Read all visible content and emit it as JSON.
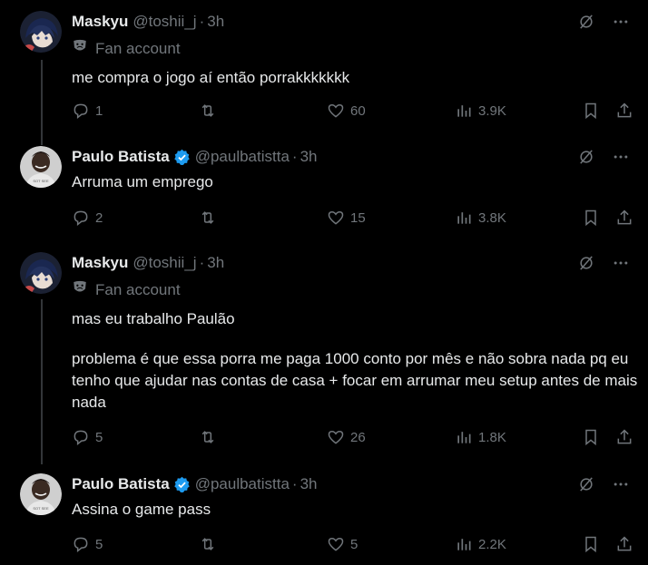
{
  "posts": [
    {
      "name": "Maskyu",
      "handle": "@toshii_j",
      "separator": "·",
      "time": "3h",
      "fan_label": "Fan account",
      "text": [
        "me compra o jogo aí então porrakkkkkkk"
      ],
      "replies": "1",
      "reposts": "",
      "likes": "60",
      "views": "3.9K"
    },
    {
      "name": "Paulo Batista",
      "handle": "@paulbatistta",
      "separator": "·",
      "time": "3h",
      "text": [
        "Arruma um emprego"
      ],
      "replies": "2",
      "reposts": "",
      "likes": "15",
      "views": "3.8K"
    },
    {
      "name": "Maskyu",
      "handle": "@toshii_j",
      "separator": "·",
      "time": "3h",
      "fan_label": "Fan account",
      "text": [
        "mas eu trabalho Paulão",
        "problema é que essa porra me paga 1000 conto por mês e não sobra nada pq eu tenho que ajudar nas contas de casa + focar em arrumar meu setup antes de mais nada"
      ],
      "replies": "5",
      "reposts": "",
      "likes": "26",
      "views": "1.8K"
    },
    {
      "name": "Paulo Batista",
      "handle": "@paulbatistta",
      "separator": "·",
      "time": "3h",
      "text": [
        "Assina o game pass"
      ],
      "replies": "5",
      "reposts": "",
      "likes": "5",
      "views": "2.2K"
    }
  ],
  "colors": {
    "background": "#000000",
    "text": "#e7e9ea",
    "muted": "#71767b",
    "verified": "#1d9bf0",
    "thread_line": "#333639"
  },
  "icons": [
    "grok-icon",
    "more-icon",
    "theater-mask-icon",
    "reply-icon",
    "repost-icon",
    "like-icon",
    "views-icon",
    "bookmark-icon",
    "share-icon",
    "verified-badge-icon"
  ]
}
